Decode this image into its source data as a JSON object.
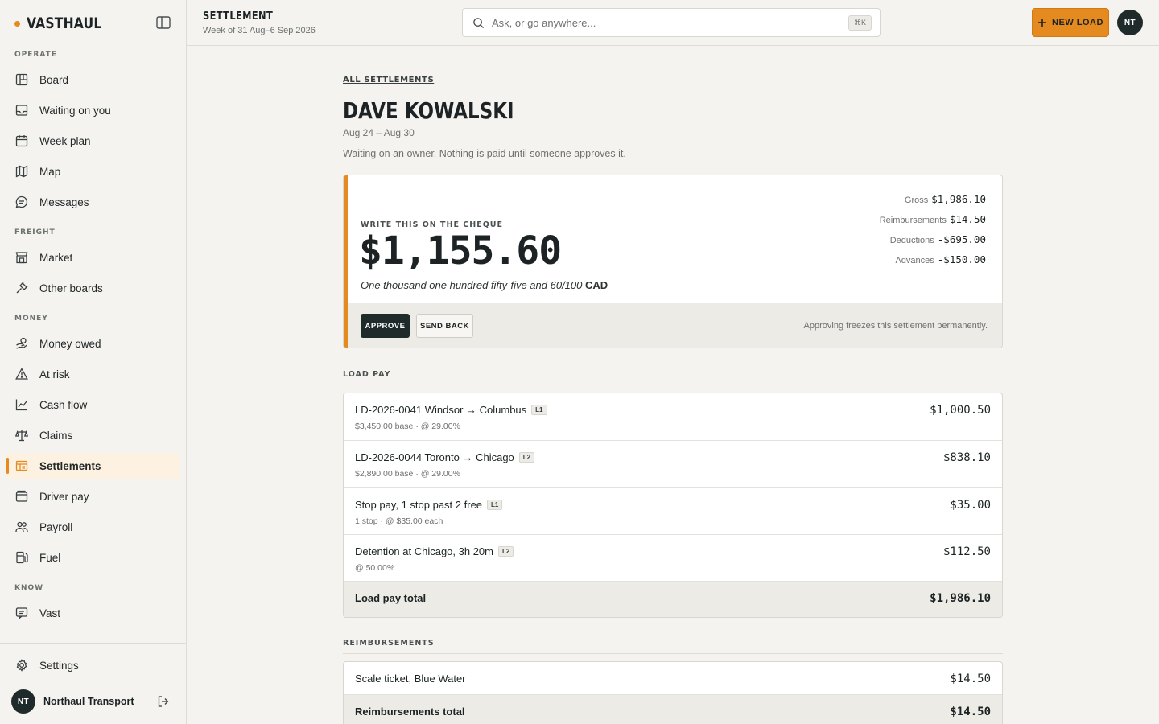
{
  "app": {
    "name": "VASTHAUL"
  },
  "sidebar": {
    "sections": {
      "operate": "OPERATE",
      "freight": "FREIGHT",
      "money": "MONEY",
      "know": "KNOW"
    },
    "items": [
      {
        "label": "Board",
        "icon": "board-icon"
      },
      {
        "label": "Waiting on you",
        "icon": "inbox-icon"
      },
      {
        "label": "Week plan",
        "icon": "calendar-icon"
      },
      {
        "label": "Map",
        "icon": "map-icon"
      },
      {
        "label": "Messages",
        "icon": "chat-icon"
      },
      {
        "label": "Market",
        "icon": "store-icon"
      },
      {
        "label": "Other boards",
        "icon": "plug-icon"
      },
      {
        "label": "Money owed",
        "icon": "hand-coins-icon"
      },
      {
        "label": "At risk",
        "icon": "warning-icon"
      },
      {
        "label": "Cash flow",
        "icon": "trend-icon"
      },
      {
        "label": "Claims",
        "icon": "scale-icon"
      },
      {
        "label": "Settlements",
        "icon": "settlements-icon",
        "active": true
      },
      {
        "label": "Driver pay",
        "icon": "wallet-icon"
      },
      {
        "label": "Payroll",
        "icon": "users-icon"
      },
      {
        "label": "Fuel",
        "icon": "fuel-icon"
      },
      {
        "label": "Vast",
        "icon": "message-square-icon"
      }
    ],
    "settings_label": "Settings",
    "org": {
      "initials": "NT",
      "name": "Northaul Transport"
    }
  },
  "topbar": {
    "title": "SETTLEMENT",
    "subtitle": "Week of 31 Aug–6 Sep 2026",
    "search_placeholder": "Ask, or go anywhere...",
    "shortcut": "⌘K",
    "new_load_label": "NEW LOAD",
    "user_initials": "NT"
  },
  "page": {
    "breadcrumb": "ALL SETTLEMENTS",
    "driver_name": "DAVE KOWALSKI",
    "period": "Aug 24 – Aug 30",
    "status_note": "Waiting on an owner. Nothing is paid until someone approves it."
  },
  "cheque": {
    "label": "WRITE THIS ON THE CHEQUE",
    "amount": "$1,155.60",
    "words": "One thousand one hundred fifty-five and 60/100",
    "currency": "CAD",
    "breakdown": [
      {
        "label": "Gross",
        "value": "$1,986.10"
      },
      {
        "label": "Reimbursements",
        "value": "$14.50"
      },
      {
        "label": "Deductions",
        "value": "-$695.00"
      },
      {
        "label": "Advances",
        "value": "-$150.00"
      }
    ],
    "approve_label": "APPROVE",
    "send_back_label": "SEND BACK",
    "footer_note": "Approving freezes this settlement permanently."
  },
  "load_pay": {
    "heading": "LOAD PAY",
    "rows": [
      {
        "title": "LD-2026-0041 Windsor → Columbus",
        "badge": "L1",
        "sub": "$3,450.00 base · @ 29.00%",
        "amount": "$1,000.50"
      },
      {
        "title": "LD-2026-0044 Toronto → Chicago",
        "badge": "L2",
        "sub": "$2,890.00 base · @ 29.00%",
        "amount": "$838.10"
      },
      {
        "title": "Stop pay, 1 stop past 2 free",
        "badge": "L1",
        "sub": "1 stop · @ $35.00 each",
        "amount": "$35.00"
      },
      {
        "title": "Detention at Chicago, 3h 20m",
        "badge": "L2",
        "sub": "@ 50.00%",
        "amount": "$112.50"
      }
    ],
    "total_label": "Load pay total",
    "total_amount": "$1,986.10"
  },
  "reimbursements": {
    "heading": "REIMBURSEMENTS",
    "rows": [
      {
        "title": "Scale ticket, Blue Water",
        "amount": "$14.50"
      }
    ],
    "total_label": "Reimbursements total",
    "total_amount": "$14.50"
  },
  "colors": {
    "accent": "#e58a1f",
    "dark": "#1f2a2b",
    "background": "#f4f3ef"
  }
}
